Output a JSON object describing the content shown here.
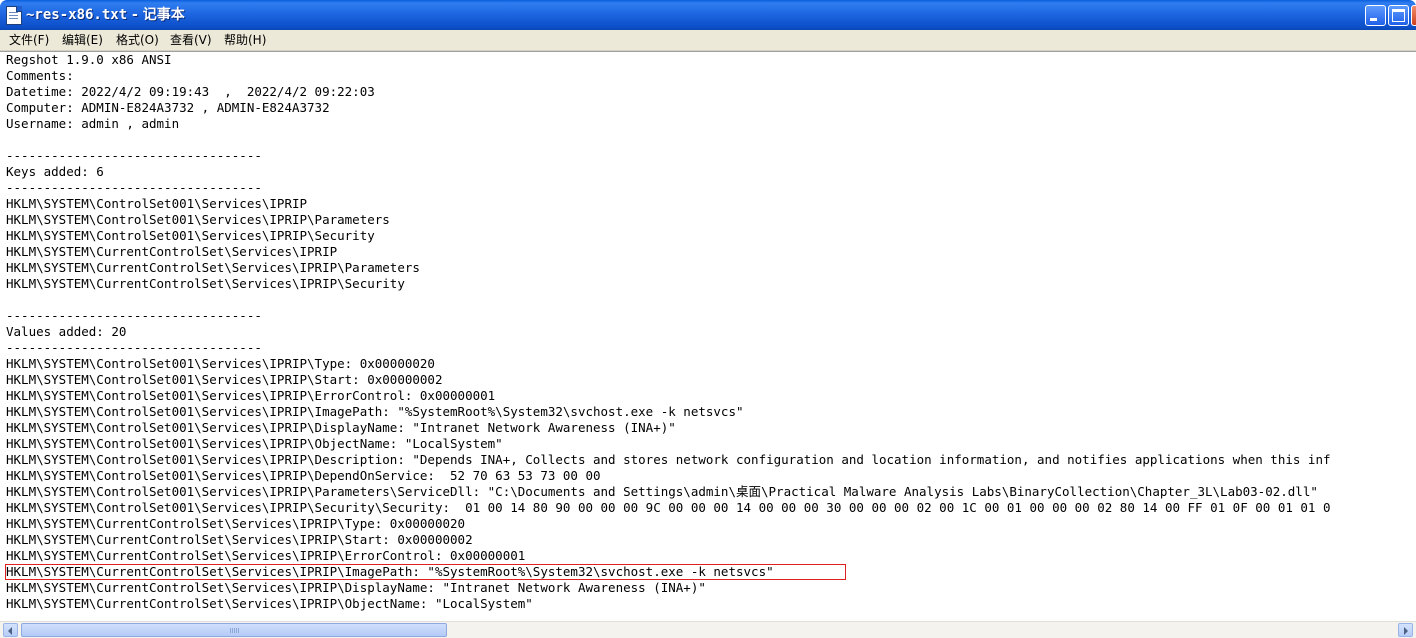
{
  "window": {
    "title_file": "~res-x86.txt",
    "title_sep": " - ",
    "title_app": "记事本",
    "icon": "notepad-icon"
  },
  "menu": [
    {
      "label": "文件(F)"
    },
    {
      "label": "编辑(E)"
    },
    {
      "label": "格式(O)"
    },
    {
      "label": "查看(V)"
    },
    {
      "label": "帮助(H)"
    }
  ],
  "lines": [
    "Regshot 1.9.0 x86 ANSI",
    "Comments:",
    "Datetime: 2022/4/2 09:19:43  ,  2022/4/2 09:22:03",
    "Computer: ADMIN-E824A3732 , ADMIN-E824A3732",
    "Username: admin , admin",
    "",
    "----------------------------------",
    "Keys added: 6",
    "----------------------------------",
    "HKLM\\SYSTEM\\ControlSet001\\Services\\IPRIP",
    "HKLM\\SYSTEM\\ControlSet001\\Services\\IPRIP\\Parameters",
    "HKLM\\SYSTEM\\ControlSet001\\Services\\IPRIP\\Security",
    "HKLM\\SYSTEM\\CurrentControlSet\\Services\\IPRIP",
    "HKLM\\SYSTEM\\CurrentControlSet\\Services\\IPRIP\\Parameters",
    "HKLM\\SYSTEM\\CurrentControlSet\\Services\\IPRIP\\Security",
    "",
    "----------------------------------",
    "Values added: 20",
    "----------------------------------",
    "HKLM\\SYSTEM\\ControlSet001\\Services\\IPRIP\\Type: 0x00000020",
    "HKLM\\SYSTEM\\ControlSet001\\Services\\IPRIP\\Start: 0x00000002",
    "HKLM\\SYSTEM\\ControlSet001\\Services\\IPRIP\\ErrorControl: 0x00000001",
    "HKLM\\SYSTEM\\ControlSet001\\Services\\IPRIP\\ImagePath: \"%SystemRoot%\\System32\\svchost.exe -k netsvcs\"",
    "HKLM\\SYSTEM\\ControlSet001\\Services\\IPRIP\\DisplayName: \"Intranet Network Awareness (INA+)\"",
    "HKLM\\SYSTEM\\ControlSet001\\Services\\IPRIP\\ObjectName: \"LocalSystem\"",
    "HKLM\\SYSTEM\\ControlSet001\\Services\\IPRIP\\Description: \"Depends INA+, Collects and stores network configuration and location information, and notifies applications when this inf",
    "HKLM\\SYSTEM\\ControlSet001\\Services\\IPRIP\\DependOnService:  52 70 63 53 73 00 00",
    "HKLM\\SYSTEM\\ControlSet001\\Services\\IPRIP\\Parameters\\ServiceDll: \"C:\\Documents and Settings\\admin\\桌面\\Practical Malware Analysis Labs\\BinaryCollection\\Chapter_3L\\Lab03-02.dll\"",
    "HKLM\\SYSTEM\\ControlSet001\\Services\\IPRIP\\Security\\Security:  01 00 14 80 90 00 00 00 9C 00 00 00 14 00 00 00 30 00 00 00 02 00 1C 00 01 00 00 00 02 80 14 00 FF 01 0F 00 01 01 0",
    "HKLM\\SYSTEM\\CurrentControlSet\\Services\\IPRIP\\Type: 0x00000020",
    "HKLM\\SYSTEM\\CurrentControlSet\\Services\\IPRIP\\Start: 0x00000002",
    "HKLM\\SYSTEM\\CurrentControlSet\\Services\\IPRIP\\ErrorControl: 0x00000001",
    "HKLM\\SYSTEM\\CurrentControlSet\\Services\\IPRIP\\ImagePath: \"%SystemRoot%\\System32\\svchost.exe -k netsvcs\"",
    "HKLM\\SYSTEM\\CurrentControlSet\\Services\\IPRIP\\DisplayName: \"Intranet Network Awareness (INA+)\"",
    "HKLM\\SYSTEM\\CurrentControlSet\\Services\\IPRIP\\ObjectName: \"LocalSystem\""
  ],
  "highlighted_line_index": 32,
  "colors": {
    "titlebar": "#0a5fdc",
    "menubar": "#ece9d8",
    "highlight": "#e02020"
  }
}
